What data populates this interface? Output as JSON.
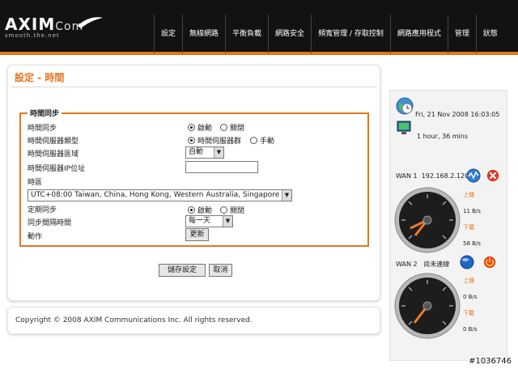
{
  "header": {
    "logo_brand": "AXIM",
    "logo_com": "Com",
    "logo_tagline": "smooth.the.net",
    "nav": [
      "設定",
      "無線網路",
      "平衡負載",
      "網路安全",
      "頻寬管理 / 存取控制",
      "網路應用程式",
      "管理",
      "狀態"
    ]
  },
  "main": {
    "title": "設定 - 時間",
    "legend": "時間同步",
    "labels": {
      "sync": "時間同步",
      "server_type": "時間伺服器類型",
      "server_zone": "時間伺服器區域",
      "server_ip": "時間伺服器IP位址",
      "timezone": "時區",
      "periodic": "定期同步",
      "interval": "同步間隔時間",
      "action": "動作"
    },
    "options": {
      "enable": "啟動",
      "disable": "關閉",
      "server_group": "時間伺服器群",
      "manual": "手動"
    },
    "server_zone_value": "自動",
    "server_ip_value": "",
    "timezone_value": "UTC+08:00 Taiwan, China, Hong Kong, Western Australia, Singapore",
    "interval_value": "每一天",
    "update_button": "更新",
    "save_button": "儲存設定",
    "cancel_button": "取消"
  },
  "footer": {
    "copyright": "Copyright © 2008 AXIM Communications Inc. All rights reserved."
  },
  "sidebar": {
    "datetime": "Fri, 21 Nov 2008 16:03:05",
    "uptime": "1 hour, 36 mins",
    "wan1": {
      "label": "WAN 1",
      "ip": "192.168.2.120",
      "up_label": "上傳",
      "up_value": "11 B/s",
      "down_label": "下載",
      "down_value": "58 B/s"
    },
    "wan2": {
      "label": "WAN 2",
      "status": "尚未連線",
      "up_label": "上傳",
      "up_value": "0 B/s",
      "down_label": "下載",
      "down_value": "0 B/s"
    }
  },
  "watermark": "#1036746",
  "colors": {
    "accent": "#e2771f",
    "header_bg": "#121212"
  }
}
